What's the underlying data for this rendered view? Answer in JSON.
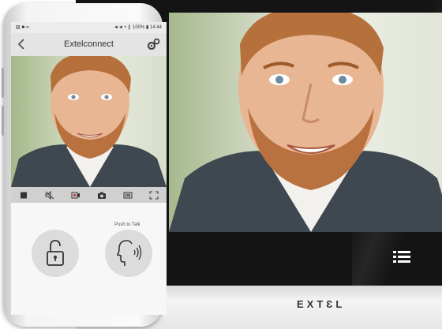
{
  "monitor": {
    "brand": "EXTƐL",
    "menu_icon": "hamburger-list-icon",
    "video_feed": "visitor-camera-feed"
  },
  "phone": {
    "status_bar": {
      "left_icons": "▧ ■ ∞",
      "right": "◄◄ • ❙ 100% ▮ 14:44"
    },
    "app_bar": {
      "title": "Extelconnect",
      "back_icon": "chevron-left-icon",
      "settings_icon": "gears-icon"
    },
    "toolbar": [
      {
        "name": "stop-icon"
      },
      {
        "name": "mute-speaker-icon"
      },
      {
        "name": "record-video-icon"
      },
      {
        "name": "camera-snapshot-icon"
      },
      {
        "name": "keypad-icon"
      },
      {
        "name": "fullscreen-icon"
      }
    ],
    "controls": {
      "push_to_talk_label": "Push to Talk",
      "unlock_icon": "unlock-padlock-icon",
      "talk_icon": "talking-head-icon"
    }
  }
}
